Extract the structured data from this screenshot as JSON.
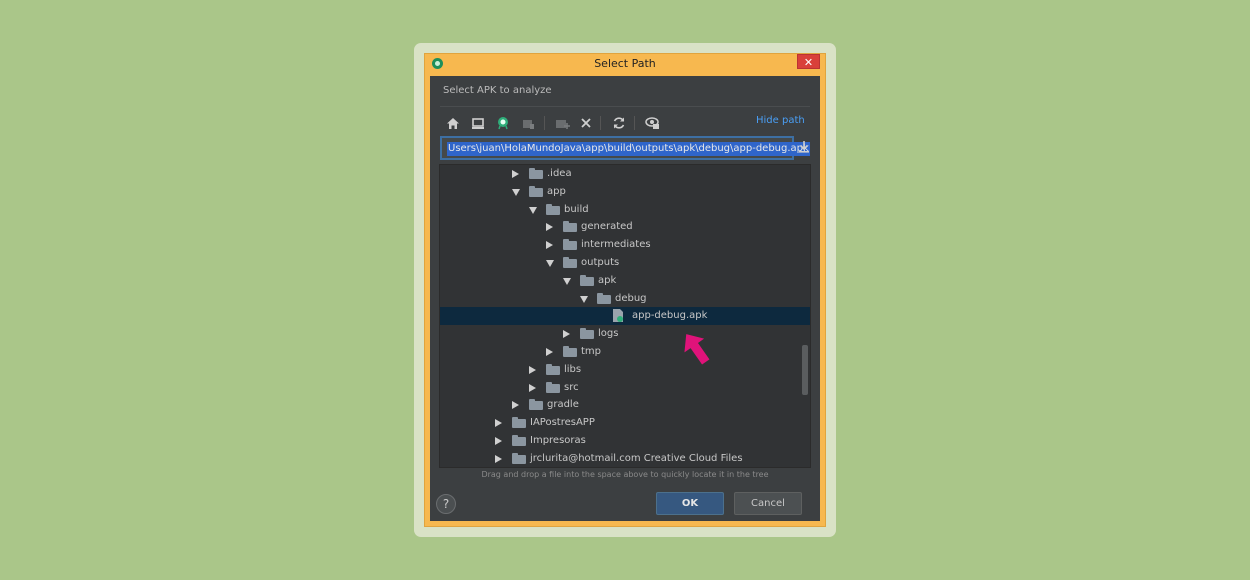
{
  "window": {
    "title": "Select Path",
    "close_glyph": "✕"
  },
  "dialog": {
    "subtitle": "Select APK to analyze",
    "hide_path_label": "Hide path",
    "path_value": "Users\\juan\\HolaMundoJava\\app\\build\\outputs\\apk\\debug\\app-debug.apk",
    "hint": "Drag and drop a file into the space above to quickly locate it in the tree",
    "help_glyph": "?",
    "ok_label": "OK",
    "cancel_label": "Cancel"
  },
  "toolbar": {
    "icons": [
      "home-icon",
      "desktop-icon",
      "android-project-icon",
      "module-icon",
      "new-folder-icon",
      "delete-icon",
      "refresh-icon",
      "show-hidden-icon"
    ]
  },
  "tree": {
    "rows": [
      {
        "label": ".idea",
        "depth": 4,
        "state": "collapsed",
        "type": "folder"
      },
      {
        "label": "app",
        "depth": 4,
        "state": "expanded",
        "type": "folder"
      },
      {
        "label": "build",
        "depth": 5,
        "state": "expanded",
        "type": "folder"
      },
      {
        "label": "generated",
        "depth": 6,
        "state": "collapsed",
        "type": "folder"
      },
      {
        "label": "intermediates",
        "depth": 6,
        "state": "collapsed",
        "type": "folder"
      },
      {
        "label": "outputs",
        "depth": 6,
        "state": "expanded",
        "type": "folder"
      },
      {
        "label": "apk",
        "depth": 7,
        "state": "expanded",
        "type": "folder"
      },
      {
        "label": "debug",
        "depth": 8,
        "state": "expanded",
        "type": "folder"
      },
      {
        "label": "app-debug.apk",
        "depth": 9,
        "state": "leaf",
        "type": "apk",
        "selected": true
      },
      {
        "label": "logs",
        "depth": 7,
        "state": "collapsed",
        "type": "folder"
      },
      {
        "label": "tmp",
        "depth": 6,
        "state": "collapsed",
        "type": "folder"
      },
      {
        "label": "libs",
        "depth": 5,
        "state": "collapsed",
        "type": "folder"
      },
      {
        "label": "src",
        "depth": 5,
        "state": "collapsed",
        "type": "folder"
      },
      {
        "label": "gradle",
        "depth": 4,
        "state": "collapsed",
        "type": "folder"
      },
      {
        "label": "IAPostresAPP",
        "depth": 3,
        "state": "collapsed",
        "type": "folder"
      },
      {
        "label": "Impresoras",
        "depth": 3,
        "state": "collapsed",
        "type": "special-folder"
      },
      {
        "label": "jrclurita@hotmail.com Creative Cloud Files",
        "depth": 3,
        "state": "collapsed",
        "type": "folder"
      }
    ]
  },
  "colors": {
    "background": "#aac689",
    "window_frame": "#f7b84f",
    "panel": "#3c3f41",
    "selection": "#0d293e",
    "link": "#4a9ff5",
    "annotation_arrow": "#e0137a"
  }
}
